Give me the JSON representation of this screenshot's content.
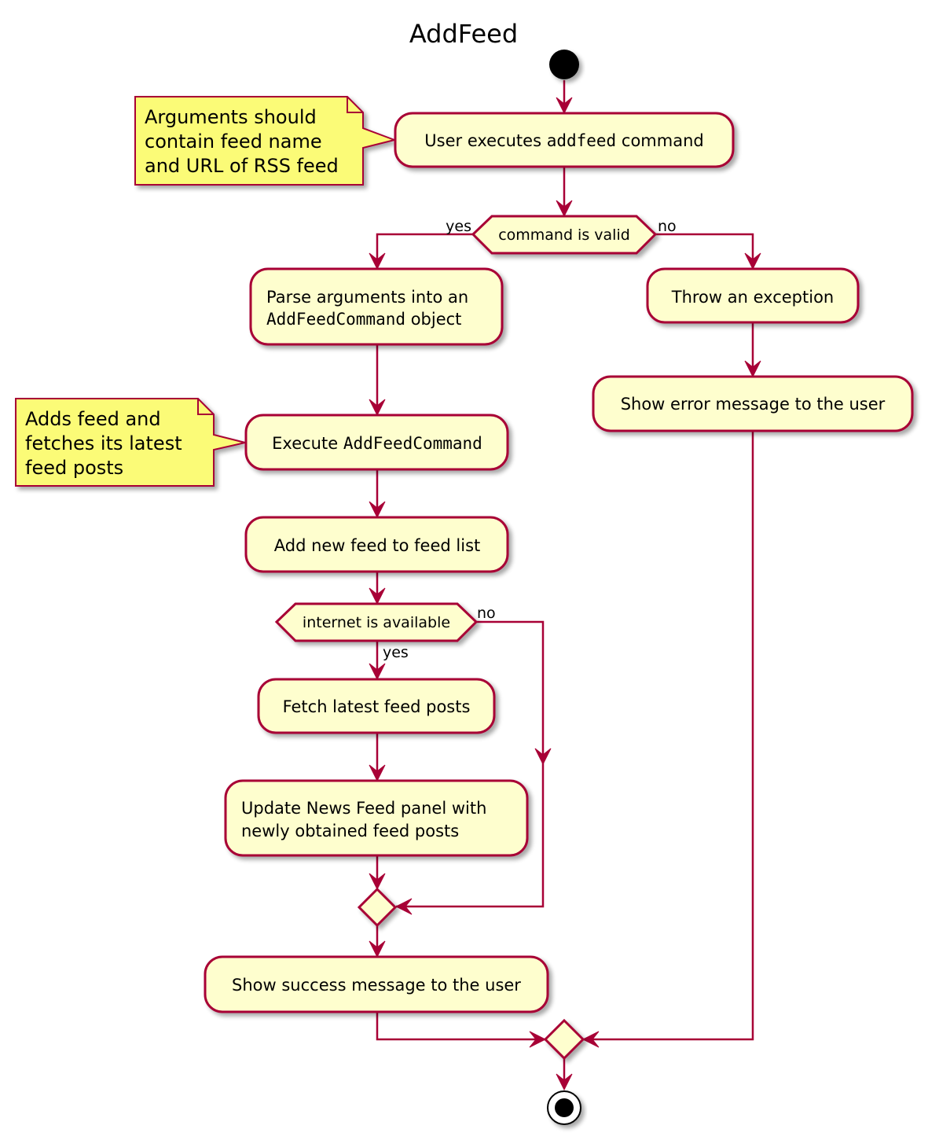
{
  "diagram": {
    "title": "AddFeed",
    "colors": {
      "line": "#A80036",
      "activity_fill": "#FEFECE",
      "note_fill": "#FBFB77",
      "start_end": "#000000"
    },
    "start": {
      "label": "start"
    },
    "end": {
      "label": "stop"
    },
    "activities": [
      {
        "id": "user-executes",
        "parts": [
          [
            "User executes ",
            "plain"
          ],
          [
            "addfeed",
            "mono"
          ],
          [
            " command",
            "plain"
          ]
        ]
      },
      {
        "id": "parse-arguments",
        "lines": [
          [
            [
              "Parse arguments into an",
              "plain"
            ]
          ],
          [
            [
              "AddFeedCommand",
              "mono"
            ],
            [
              " object",
              "plain"
            ]
          ]
        ]
      },
      {
        "id": "execute-command",
        "parts": [
          [
            "Execute ",
            "plain"
          ],
          [
            "AddFeedCommand",
            "mono"
          ]
        ]
      },
      {
        "id": "add-feed",
        "text": "Add new feed to feed list"
      },
      {
        "id": "fetch-posts",
        "text": "Fetch latest feed posts"
      },
      {
        "id": "update-panel",
        "lines_text": [
          "Update News Feed panel with",
          "newly obtained feed posts"
        ]
      },
      {
        "id": "show-success",
        "text": "Show success message to the user"
      },
      {
        "id": "throw-exception",
        "text": "Throw an exception"
      },
      {
        "id": "show-error",
        "text": "Show error message to the user"
      }
    ],
    "decisions": [
      {
        "id": "command-valid",
        "text": "command is valid",
        "yes": "yes",
        "no": "no"
      },
      {
        "id": "internet-available",
        "text": "internet is available",
        "yes": "yes",
        "no": "no"
      }
    ],
    "notes": [
      {
        "id": "arguments-note",
        "lines": [
          "Arguments should",
          "contain feed name",
          "and URL of RSS feed"
        ]
      },
      {
        "id": "adds-feed-note",
        "lines": [
          "Adds feed and",
          "fetches its latest",
          "feed posts"
        ]
      }
    ]
  }
}
